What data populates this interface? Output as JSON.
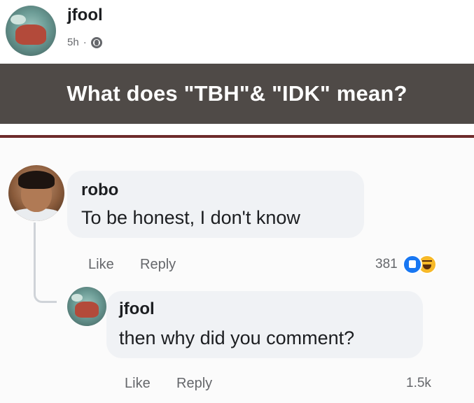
{
  "post": {
    "author": "jfool",
    "time": "5h",
    "separator": "·",
    "privacy_icon": "globe-icon",
    "banner_text": "What does \"TBH\"& \"IDK\" mean?"
  },
  "comments": [
    {
      "author": "robo",
      "text": "To be honest, I don't know",
      "like_label": "Like",
      "reply_label": "Reply",
      "reaction_count": "381",
      "reactions": [
        "like-react-icon",
        "haha-react-icon"
      ]
    },
    {
      "author": "jfool",
      "text": "then why did you comment?",
      "like_label": "Like",
      "reply_label": "Reply",
      "reaction_count": "1.5k"
    }
  ],
  "colors": {
    "banner_bg": "#4f4a47",
    "divider": "#6e2b2b",
    "bubble_bg": "#f0f2f5",
    "like_blue": "#1877f2",
    "haha_yellow": "#f7b928"
  }
}
